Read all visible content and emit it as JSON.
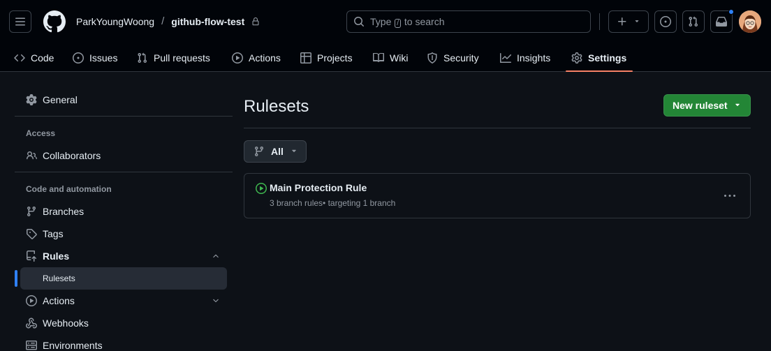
{
  "header": {
    "owner": "ParkYoungWoong",
    "separator": "/",
    "repo": "github-flow-test",
    "search": {
      "prefix": "Type",
      "key": "/",
      "suffix": "to search"
    },
    "notification_dot_color": "#2f81f7"
  },
  "tabs": [
    {
      "label": "Code",
      "icon": "code-icon"
    },
    {
      "label": "Issues",
      "icon": "issue-opened-icon"
    },
    {
      "label": "Pull requests",
      "icon": "git-pull-request-icon"
    },
    {
      "label": "Actions",
      "icon": "play-icon"
    },
    {
      "label": "Projects",
      "icon": "table-icon"
    },
    {
      "label": "Wiki",
      "icon": "book-icon"
    },
    {
      "label": "Security",
      "icon": "shield-icon"
    },
    {
      "label": "Insights",
      "icon": "graph-icon"
    },
    {
      "label": "Settings",
      "icon": "gear-icon",
      "active": true
    }
  ],
  "sidebar": {
    "general": "General",
    "access_header": "Access",
    "collaborators": "Collaborators",
    "code_header": "Code and automation",
    "branches": "Branches",
    "tags": "Tags",
    "rules": "Rules",
    "rulesets": "Rulesets",
    "actions": "Actions",
    "webhooks": "Webhooks",
    "environments": "Environments"
  },
  "main": {
    "title": "Rulesets",
    "new_button": "New ruleset",
    "filter": "All",
    "rulesets": [
      {
        "name": "Main Protection Rule",
        "meta": "3 branch rules• targeting 1 branch",
        "status": "active"
      }
    ]
  },
  "colors": {
    "background": "#0d1117",
    "header": "#010409",
    "primary_button": "#238636",
    "active_tab_underline": "#f78166",
    "active_indicator": "#2f81f7",
    "active_status": "#3fb950"
  }
}
